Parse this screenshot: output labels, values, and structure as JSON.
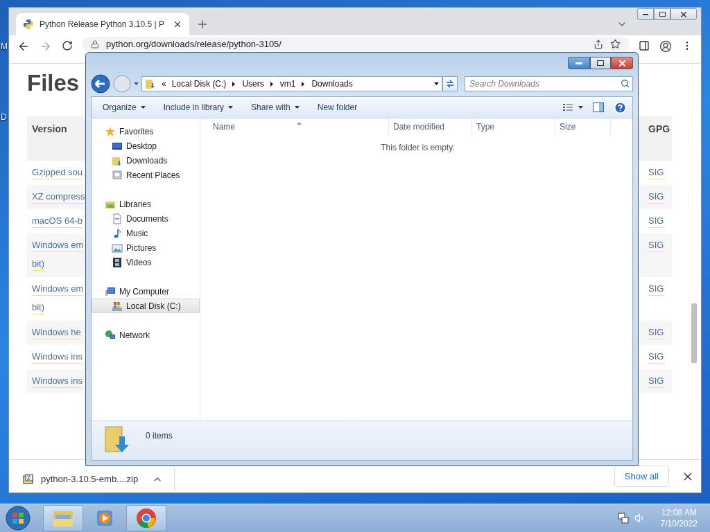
{
  "desktop": {
    "icon_labels": [
      "M",
      "D"
    ]
  },
  "browser": {
    "tab": {
      "title": "Python Release Python 3.10.5 | P"
    },
    "url": "python.org/downloads/release/python-3105/",
    "page": {
      "heading": "Files",
      "columns": [
        "Version",
        "GPG"
      ],
      "rows": [
        {
          "version": [
            "Gzipped sou"
          ],
          "gpg": "SIG"
        },
        {
          "version": [
            "XZ compress"
          ],
          "gpg": "SIG"
        },
        {
          "version": [
            "macOS 64-b"
          ],
          "gpg": "SIG"
        },
        {
          "version": [
            "Windows em",
            "bit)"
          ],
          "gpg": "SIG"
        },
        {
          "version": [
            "Windows em",
            "bit)"
          ],
          "gpg": "SIG"
        },
        {
          "version": [
            "Windows he"
          ],
          "gpg": "SIG"
        },
        {
          "version": [
            "Windows ins"
          ],
          "gpg": "SIG"
        },
        {
          "version": [
            "Windows ins"
          ],
          "gpg": "SIG"
        }
      ]
    },
    "download": {
      "file": "python-3.10.5-emb....zip",
      "show_all": "Show all"
    }
  },
  "explorer": {
    "overflow": "«",
    "breadcrumbs": [
      "Local Disk (C:)",
      "Users",
      "vm1",
      "Downloads"
    ],
    "search": {
      "placeholder": "Search Downloads"
    },
    "commands": [
      {
        "label": "Organize",
        "menu": true
      },
      {
        "label": "Include in library",
        "menu": true
      },
      {
        "label": "Share with",
        "menu": true
      },
      {
        "label": "New folder",
        "menu": false
      }
    ],
    "nav": [
      {
        "label": "Favorites",
        "kind": "star",
        "selected": false,
        "children": [
          {
            "label": "Desktop",
            "kind": "desktop",
            "selected": false
          },
          {
            "label": "Downloads",
            "kind": "downloads",
            "selected": false
          },
          {
            "label": "Recent Places",
            "kind": "recent",
            "selected": false
          }
        ]
      },
      {
        "label": "Libraries",
        "kind": "library",
        "selected": false,
        "children": [
          {
            "label": "Documents",
            "kind": "document",
            "selected": false
          },
          {
            "label": "Music",
            "kind": "music",
            "selected": false
          },
          {
            "label": "Pictures",
            "kind": "pictures",
            "selected": false
          },
          {
            "label": "Videos",
            "kind": "videos",
            "selected": false
          }
        ]
      },
      {
        "label": "My Computer",
        "kind": "computer",
        "selected": false,
        "children": [
          {
            "label": "Local Disk (C:)",
            "kind": "disk",
            "selected": true
          }
        ]
      },
      {
        "label": "Network",
        "kind": "network",
        "selected": false
      }
    ],
    "columns": [
      "Name",
      "Date modified",
      "Type",
      "Size"
    ],
    "empty_message": "This folder is empty.",
    "item_count": "0 items"
  },
  "taskbar": {
    "apps": [
      {
        "kind": "explorer",
        "running": true
      },
      {
        "kind": "media",
        "running": false
      },
      {
        "kind": "chrome",
        "running": true
      }
    ],
    "clock": {
      "time": "12:08 AM",
      "date": "7/10/2022"
    }
  }
}
